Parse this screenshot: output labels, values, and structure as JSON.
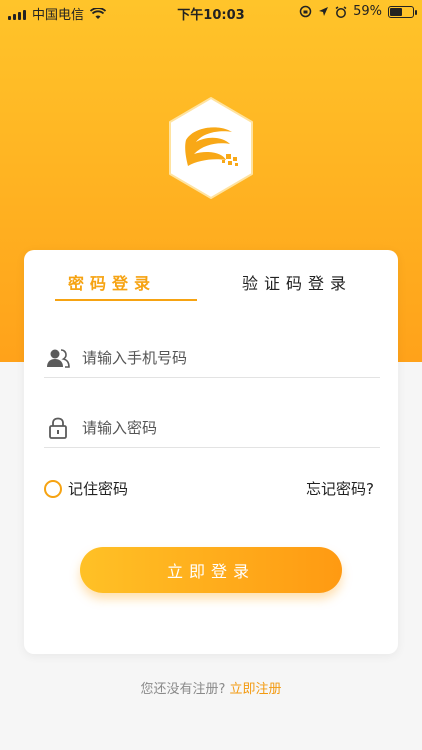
{
  "status_bar": {
    "carrier": "中国电信",
    "time": "下午10:03",
    "battery": "59%",
    "battery_level": 0.59
  },
  "login": {
    "tabs": [
      "密码登录",
      "验证码登录"
    ],
    "active_tab": 0,
    "phone_placeholder": "请输入手机号码",
    "password_placeholder": "请输入密码",
    "remember_label": "记住密码",
    "forgot_label": "忘记密码?",
    "submit_label": "立即登录"
  },
  "footer": {
    "prompt": "您还没有注册?",
    "register_link": "立即注册"
  },
  "colors": {
    "accent": "#f6a312",
    "hero_top": "#ffc42a",
    "hero_bottom": "#ffa21a"
  },
  "icons": [
    "wifi-icon",
    "rotation-lock-icon",
    "location-icon",
    "alarm-icon",
    "battery-icon",
    "user-icon",
    "lock-icon"
  ]
}
